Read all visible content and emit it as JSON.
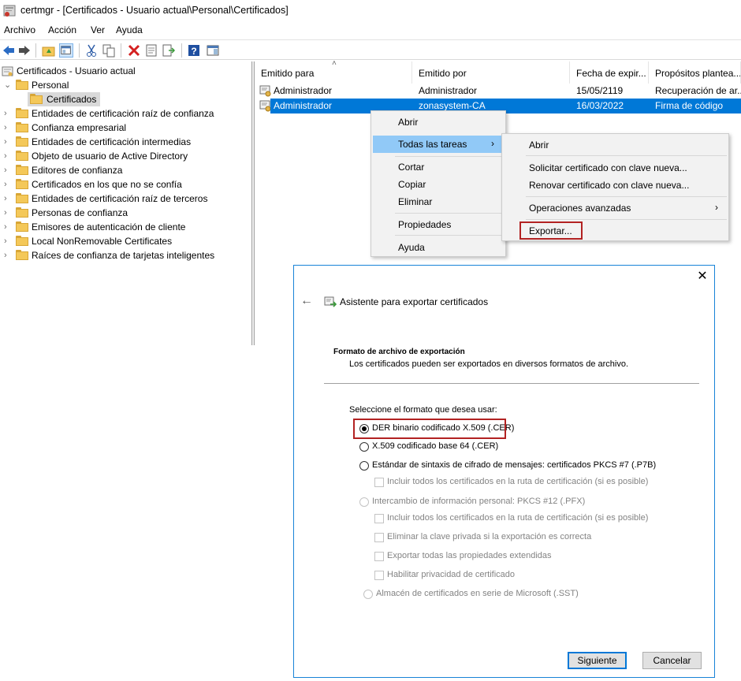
{
  "window": {
    "title": "certmgr - [Certificados - Usuario actual\\Personal\\Certificados]"
  },
  "menubar": [
    "Archivo",
    "Acción",
    "Ver",
    "Ayuda"
  ],
  "toolbar": {
    "icons": [
      "back-icon",
      "forward-icon",
      "up-folder-icon",
      "show-hide-tree-icon",
      "cut-icon",
      "copy-icon",
      "delete-icon",
      "properties-icon",
      "export-list-icon",
      "help-icon",
      "action-pane-icon"
    ]
  },
  "tree": {
    "root": "Certificados - Usuario actual",
    "personal": "Personal",
    "certificados": "Certificados",
    "items": [
      "Entidades de certificación raíz de confianza",
      "Confianza empresarial",
      "Entidades de certificación intermedias",
      "Objeto de usuario de Active Directory",
      "Editores de confianza",
      "Certificados en los que no se confía",
      "Entidades de certificación raíz de terceros",
      "Personas de confianza",
      "Emisores de autenticación de cliente",
      "Local NonRemovable Certificates",
      "Raíces de confianza de tarjetas inteligentes"
    ]
  },
  "list": {
    "columns": [
      "Emitido para",
      "Emitido por",
      "Fecha de expir...",
      "Propósitos plantea..."
    ],
    "rows": [
      [
        "Administrador",
        "Administrador",
        "15/05/2119",
        "Recuperación de ar..."
      ],
      [
        "Administrador",
        "zonasystem-CA",
        "16/03/2022",
        "Firma de código"
      ]
    ]
  },
  "context_menu": {
    "items": [
      "Abrir",
      "Todas las tareas",
      "Cortar",
      "Copiar",
      "Eliminar",
      "Propiedades",
      "Ayuda"
    ]
  },
  "submenu": {
    "items": [
      "Abrir",
      "Solicitar certificado con clave nueva...",
      "Renovar certificado con clave nueva...",
      "Operaciones avanzadas",
      "Exportar..."
    ]
  },
  "dialog": {
    "title": "Asistente para exportar certificados",
    "section_title": "Formato de archivo de exportación",
    "section_desc": "Los certificados pueden ser exportados en diversos formatos de archivo.",
    "prompt": "Seleccione el formato que desea usar:",
    "options": {
      "der": "DER binario codificado X.509 (.CER)",
      "base64": "X.509 codificado base 64 (.CER)",
      "pkcs7": "Estándar de sintaxis de cifrado de mensajes: certificados PKCS #7 (.P7B)",
      "pkcs7_include": "Incluir todos los certificados en la ruta de certificación (si es posible)",
      "pfx": "Intercambio de información personal: PKCS #12 (.PFX)",
      "pfx_include": "Incluir todos los certificados en la ruta de certificación (si es posible)",
      "pfx_delete_key": "Eliminar la clave privada si la exportación es correcta",
      "pfx_export_props": "Exportar todas las propiedades extendidas",
      "pfx_privacy": "Habilitar privacidad de certificado",
      "sst": "Almacén de certificados en serie de Microsoft (.SST)"
    },
    "selected_format": "der",
    "next_button": "Siguiente",
    "cancel_button": "Cancelar"
  },
  "colors": {
    "selection": "#0078d7",
    "highlight": "#91c9f7",
    "annotation_box": "#b22222"
  }
}
